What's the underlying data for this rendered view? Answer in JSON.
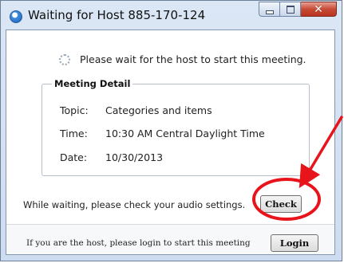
{
  "window": {
    "title": "Waiting for Host 885-170-124",
    "icon": "zoom-app-icon",
    "controls": [
      "minimize-icon",
      "maximize-icon",
      "close-icon"
    ],
    "close_glyph": "✕"
  },
  "status": {
    "icon": "spinner-icon",
    "message": "Please wait for the host to start this meeting."
  },
  "meeting_detail": {
    "legend": "Meeting Detail",
    "topic_label": "Topic:",
    "topic_value": "Categories and items",
    "time_label": "Time:",
    "time_value": "10:30 AM Central Daylight Time",
    "date_label": "Date:",
    "date_value": "10/30/2013"
  },
  "audio": {
    "prompt": "While waiting, please check your audio settings.",
    "check_label": "Check"
  },
  "footer": {
    "host_prompt": "If you are the host, please login to start this meeting",
    "login_label": "Login"
  },
  "annotation": {
    "color": "#e8141c",
    "shapes": [
      "arrow",
      "circle"
    ]
  }
}
